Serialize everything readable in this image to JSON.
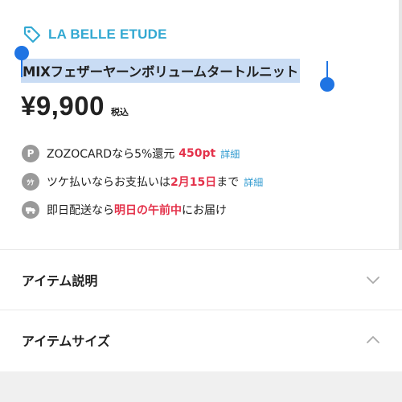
{
  "brand": {
    "name": "LA BELLE ETUDE",
    "icon": "tag-icon",
    "color": "#33a9d2"
  },
  "product": {
    "title": "MIXフェザーヤーンボリュームタートルニット",
    "price": "¥9,900",
    "tax_label": "税込"
  },
  "info": {
    "points": {
      "icon": "P",
      "prefix": "ZOZOCARDなら5%還元",
      "highlight": "450pt",
      "link": "詳細"
    },
    "tsuke": {
      "icon": "ﾂｹ",
      "prefix": "ツケ払いならお支払いは",
      "highlight": "2月15日",
      "suffix": "まで",
      "link": "詳細"
    },
    "delivery": {
      "icon": "truck-icon",
      "prefix": "即日配送なら",
      "highlight": "明日の午前中",
      "suffix": "にお届け"
    }
  },
  "sections": {
    "description": {
      "label": "アイテム説明",
      "state": "collapsed"
    },
    "size": {
      "label": "アイテムサイズ",
      "state": "expanded"
    }
  },
  "colors": {
    "accent_red": "#e4324b",
    "link_blue": "#2f9ad0",
    "selection": "#c9dcf4",
    "handle": "#1f74e3"
  }
}
